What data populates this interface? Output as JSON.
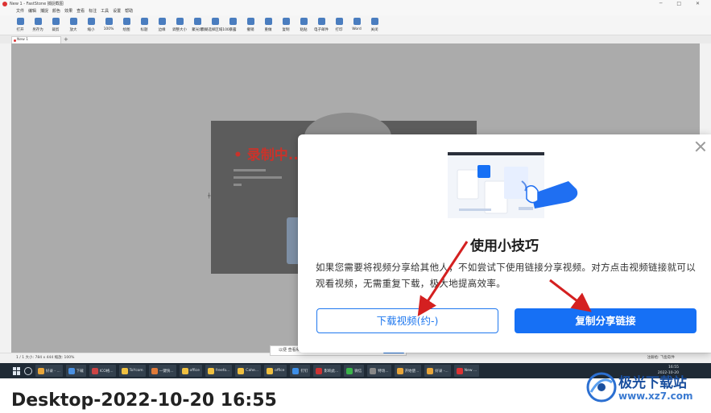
{
  "window": {
    "title": "New 1 - FastStone 捕捉截图",
    "controls": "─ □ ✕"
  },
  "menu": [
    "文件",
    "编辑",
    "捕捉",
    "颜色",
    "效果",
    "查看",
    "标注",
    "工具",
    "设置",
    "帮助"
  ],
  "toolbar": [
    {
      "label": "打开"
    },
    {
      "label": "另存为"
    },
    {
      "label": "裁剪"
    },
    {
      "label": "放大"
    },
    {
      "label": "缩小"
    },
    {
      "label": "100%"
    },
    {
      "label": "绘图"
    },
    {
      "label": "标题"
    },
    {
      "label": "边缘"
    },
    {
      "label": "调整大小"
    },
    {
      "label": "聚光灯"
    },
    {
      "label": "模糊选择区域100"
    },
    {
      "label": "暴露"
    },
    {
      "label": "撤销"
    },
    {
      "label": "重做"
    },
    {
      "label": "复制"
    },
    {
      "label": "粘贴"
    },
    {
      "label": "电子邮件"
    },
    {
      "label": "打印"
    },
    {
      "label": "Word"
    },
    {
      "label": "关闭"
    }
  ],
  "tab": {
    "label": "New 1",
    "add": "+"
  },
  "document": {
    "heading": "• 录制中..."
  },
  "statusbar": {
    "left": "1 / 1    大小: 784 x 444    缩放: 100%",
    "right": "注册给: 飞鱼软件"
  },
  "taskbar": {
    "items": [
      {
        "label": "好录 - ...",
        "color": "#e8a53a"
      },
      {
        "label": "下载",
        "color": "#4a90e2"
      },
      {
        "label": "ICO格...",
        "color": "#cc4444"
      },
      {
        "label": "ToYcom",
        "color": "#f0c040"
      },
      {
        "label": "一键快...",
        "color": "#e07b39"
      },
      {
        "label": "office",
        "color": "#f0c040"
      },
      {
        "label": "freefo...",
        "color": "#f0c040"
      },
      {
        "label": "Cahe...",
        "color": "#f0c040"
      },
      {
        "label": "office",
        "color": "#f0c040"
      },
      {
        "label": "钉钉",
        "color": "#3d8fe8"
      },
      {
        "label": "影响此...",
        "color": "#c33"
      },
      {
        "label": "微信",
        "color": "#3bb44a"
      },
      {
        "label": "特场...",
        "color": "#888"
      },
      {
        "label": "开始使...",
        "color": "#e8a53a"
      },
      {
        "label": "好录 -...",
        "color": "#e8a53a"
      },
      {
        "label": "New ...",
        "color": "#d33"
      }
    ],
    "time": "16:55",
    "date": "2022-10-20"
  },
  "hintbar": {
    "text": "以便 查看和管理录制内容"
  },
  "dialog": {
    "close_icon": "close-icon",
    "title": "使用小技巧",
    "body": "如果您需要将视频分享给其他人，不如尝试下使用链接分享视频。对方点击视频链接就可以观看视频，无需重复下载，极大地提高效率。",
    "download_button": "下载视频(约-)",
    "share_button": "复制分享链接"
  },
  "colors": {
    "accent": "#1670f5",
    "arrow": "#d42020"
  },
  "caption": "Desktop-2022-10-20  16:55",
  "watermark": {
    "title": "极光下载站",
    "url": "www.xz7.com"
  }
}
